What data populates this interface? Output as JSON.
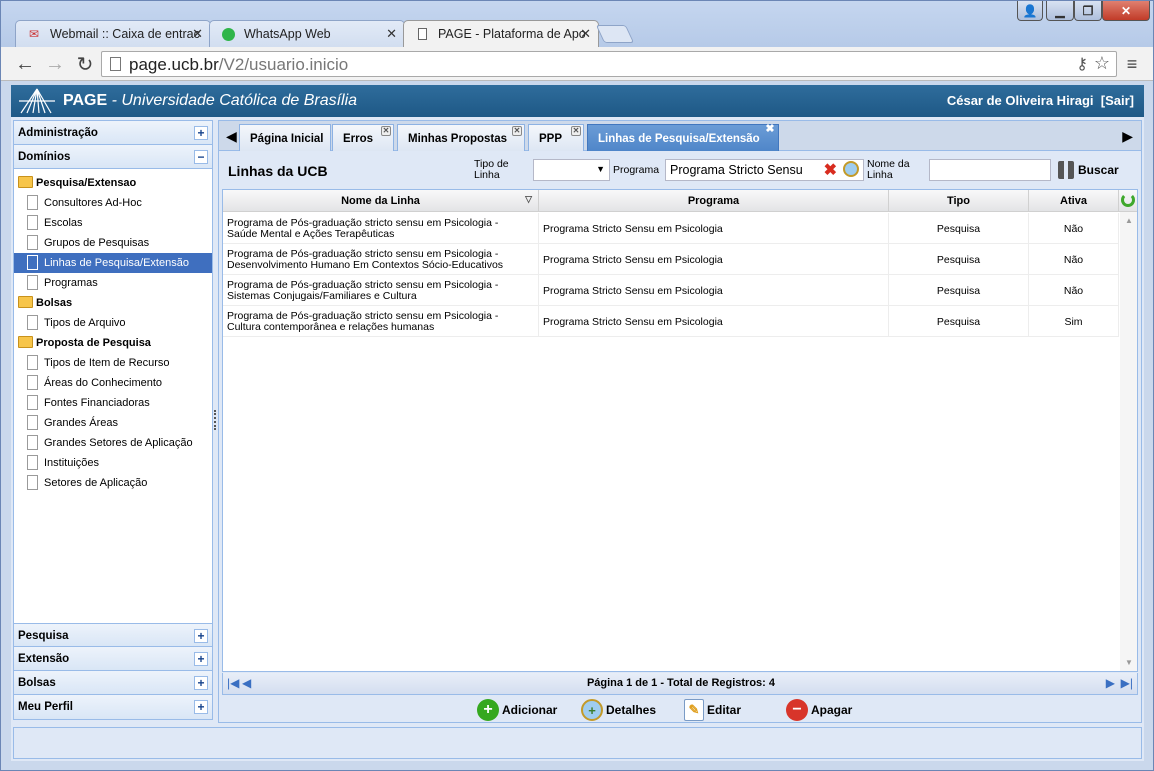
{
  "browser": {
    "tabs": [
      {
        "label": "Webmail :: Caixa de entrac",
        "icon": "webmail-icon"
      },
      {
        "label": "WhatsApp Web",
        "icon": "whatsapp-icon"
      },
      {
        "label": "PAGE - Plataforma de Apo",
        "icon": "page-icon",
        "active": true
      }
    ],
    "url_host": "page.ucb.br",
    "url_path": "/V2/usuario.inicio"
  },
  "header": {
    "brand": "PAGE",
    "subtitle": " - Universidade Católica de Brasília",
    "user": "César de Oliveira Hiragi",
    "logout": "[Sair]"
  },
  "sidebar": {
    "sections_top": [
      {
        "label": "Administração",
        "state": "+"
      },
      {
        "label": "Domínios",
        "state": "−"
      }
    ],
    "tree": [
      {
        "type": "folder",
        "label": "Pesquisa/Extensao"
      },
      {
        "type": "leaf",
        "label": "Consultores Ad-Hoc"
      },
      {
        "type": "leaf",
        "label": "Escolas"
      },
      {
        "type": "leaf",
        "label": "Grupos de Pesquisas"
      },
      {
        "type": "leaf",
        "label": "Linhas de Pesquisa/Extensão",
        "selected": true
      },
      {
        "type": "leaf",
        "label": "Programas"
      },
      {
        "type": "folder",
        "label": "Bolsas"
      },
      {
        "type": "leaf",
        "label": "Tipos de Arquivo"
      },
      {
        "type": "folder",
        "label": "Proposta de Pesquisa"
      },
      {
        "type": "leaf",
        "label": "Tipos de Item de Recurso"
      },
      {
        "type": "leaf",
        "label": "Áreas do Conhecimento"
      },
      {
        "type": "leaf",
        "label": "Fontes Financiadoras"
      },
      {
        "type": "leaf",
        "label": "Grandes Áreas"
      },
      {
        "type": "leaf",
        "label": "Grandes Setores de Aplicação"
      },
      {
        "type": "leaf",
        "label": "Instituições"
      },
      {
        "type": "leaf",
        "label": "Setores de Aplicação"
      }
    ],
    "sections_bottom": [
      {
        "label": "Pesquisa",
        "state": "+"
      },
      {
        "label": "Extensão",
        "state": "+"
      },
      {
        "label": "Bolsas",
        "state": "+"
      },
      {
        "label": "Meu Perfil",
        "state": "+"
      }
    ]
  },
  "panel_tabs": [
    {
      "label": "Página Inicial",
      "closable": false
    },
    {
      "label": "Erros",
      "closable": true
    },
    {
      "label": "Minhas Propostas",
      "closable": true
    },
    {
      "label": "PPP",
      "closable": true
    },
    {
      "label": "Linhas de Pesquisa/Extensão",
      "closable": true,
      "active": true
    }
  ],
  "filter": {
    "title": "Linhas da UCB",
    "tipo_label_1": "Tipo de",
    "tipo_label_2": "Linha",
    "tipo_value": "",
    "programa_label": "Programa",
    "programa_value": "Programa Stricto Sensu",
    "nome_label_1": "Nome da",
    "nome_label_2": "Linha",
    "nome_value": "",
    "search_label": "Buscar"
  },
  "grid": {
    "columns": [
      "Nome da Linha",
      "Programa",
      "Tipo",
      "Ativa"
    ],
    "rows": [
      {
        "nome1": "Programa de Pós-graduação stricto sensu em Psicologia -",
        "nome2": "Saúde Mental e Ações Terapêuticas",
        "programa": "Programa Stricto Sensu em Psicologia",
        "tipo": "Pesquisa",
        "ativa": "Não"
      },
      {
        "nome1": "Programa de Pós-graduação stricto sensu em Psicologia -",
        "nome2": "Desenvolvimento Humano Em Contextos Sócio-Educativos",
        "programa": "Programa Stricto Sensu em Psicologia",
        "tipo": "Pesquisa",
        "ativa": "Não"
      },
      {
        "nome1": "Programa de Pós-graduação stricto sensu em Psicologia -",
        "nome2": "Sistemas Conjugais/Familiares e Cultura",
        "programa": "Programa Stricto Sensu em Psicologia",
        "tipo": "Pesquisa",
        "ativa": "Não"
      },
      {
        "nome1": "Programa de Pós-graduação stricto sensu em Psicologia -",
        "nome2": "Cultura contemporânea e relações humanas",
        "programa": "Programa Stricto Sensu em Psicologia",
        "tipo": "Pesquisa",
        "ativa": "Sim"
      }
    ],
    "paging": "Página 1 de 1 - Total de Registros: 4"
  },
  "actions": {
    "add": "Adicionar",
    "details": "Detalhes",
    "edit": "Editar",
    "delete": "Apagar"
  },
  "colors": {
    "header_bg": "#1e5886",
    "selected": "#3f6fbf",
    "active_tab": "#4f86c9",
    "add": "#35a81f",
    "delete": "#d8352a"
  }
}
